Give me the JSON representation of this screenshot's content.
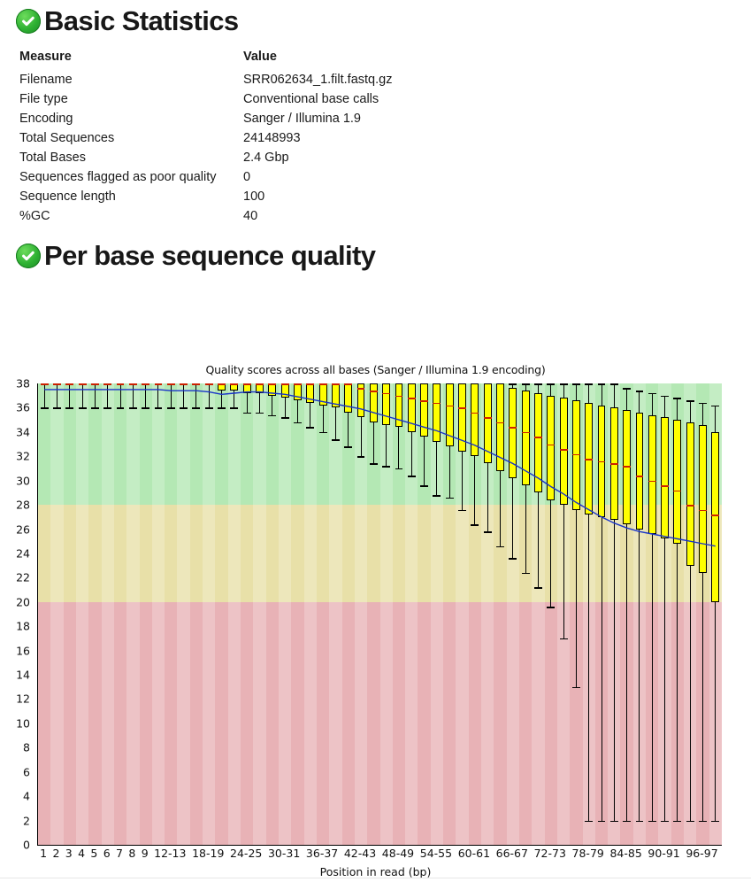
{
  "modules": [
    {
      "id": "basic-statistics",
      "title": "Basic Statistics",
      "status": "pass",
      "status_icon": "check-circle-icon",
      "status_color": "#2db032"
    },
    {
      "id": "per-base-sequence-quality",
      "title": "Per base sequence quality",
      "status": "pass",
      "status_icon": "check-circle-icon",
      "status_color": "#2db032"
    }
  ],
  "basic_statistics": {
    "headers": [
      "Measure",
      "Value"
    ],
    "rows": [
      [
        "Filename",
        "SRR062634_1.filt.fastq.gz"
      ],
      [
        "File type",
        "Conventional base calls"
      ],
      [
        "Encoding",
        "Sanger / Illumina 1.9"
      ],
      [
        "Total Sequences",
        "24148993"
      ],
      [
        "Total Bases",
        "2.4 Gbp"
      ],
      [
        "Sequences flagged as poor quality",
        "0"
      ],
      [
        "Sequence length",
        "100"
      ],
      [
        "%GC",
        "40"
      ]
    ]
  },
  "chart_data": {
    "type": "box",
    "title": "Quality scores across all bases (Sanger / Illumina 1.9 encoding)",
    "xlabel": "Position in read (bp)",
    "ylabel": "",
    "ylim": [
      0,
      38
    ],
    "ytick_step": 2,
    "yticks": [
      0,
      2,
      4,
      6,
      8,
      10,
      12,
      14,
      16,
      18,
      20,
      22,
      24,
      26,
      28,
      30,
      32,
      34,
      36,
      38
    ],
    "grid": false,
    "legend": false,
    "background_bands": [
      {
        "name": "good",
        "from": 28,
        "to": 38,
        "color": "#b4e8b4"
      },
      {
        "name": "warn",
        "from": 20,
        "to": 28,
        "color": "#e8e0a8"
      },
      {
        "name": "bad",
        "from": 0,
        "to": 20,
        "color": "#e8b2b6"
      }
    ],
    "box_color": "#ffff00",
    "median_color": "#cc2200",
    "mean_line_color": "#1a35c8",
    "whisker_color": "#000000",
    "categories": [
      "1",
      "2",
      "3",
      "4",
      "5",
      "6",
      "7",
      "8",
      "9",
      "10-11",
      "12-13",
      "14-15",
      "16-17",
      "18-19",
      "20-21",
      "22-23",
      "24-25",
      "26-27",
      "28-29",
      "30-31",
      "32-33",
      "34-35",
      "36-37",
      "38-39",
      "40-41",
      "42-43",
      "44-45",
      "46-47",
      "48-49",
      "50-51",
      "52-53",
      "54-55",
      "56-57",
      "58-59",
      "60-61",
      "62-63",
      "64-65",
      "66-67",
      "68-69",
      "70-71",
      "72-73",
      "74-75",
      "76-77",
      "78-79",
      "80-81",
      "82-83",
      "84-85",
      "86-87",
      "88-89",
      "90-91",
      "92-93",
      "94-95",
      "96-97",
      "98-99"
    ],
    "xtick_labels": [
      "1",
      "2",
      "3",
      "4",
      "5",
      "6",
      "7",
      "8",
      "9",
      "12-13",
      "18-19",
      "24-25",
      "30-31",
      "36-37",
      "42-43",
      "48-49",
      "54-55",
      "60-61",
      "66-67",
      "72-73",
      "78-79",
      "84-85",
      "90-91",
      "96-97"
    ],
    "xtick_indices": [
      0,
      1,
      2,
      3,
      4,
      5,
      6,
      7,
      8,
      10,
      13,
      16,
      19,
      22,
      25,
      28,
      31,
      34,
      37,
      40,
      43,
      46,
      49,
      52
    ],
    "series": [
      {
        "name": "mean quality",
        "values": [
          37.5,
          37.5,
          37.5,
          37.5,
          37.5,
          37.5,
          37.5,
          37.5,
          37.5,
          37.5,
          37.4,
          37.4,
          37.4,
          37.3,
          37.1,
          37.2,
          37.3,
          37.3,
          37.2,
          37.1,
          36.9,
          36.7,
          36.5,
          36.3,
          36.1,
          35.9,
          35.6,
          35.3,
          35.0,
          34.7,
          34.4,
          34.1,
          33.7,
          33.3,
          32.9,
          32.4,
          31.9,
          31.4,
          30.8,
          30.2,
          29.5,
          28.9,
          28.2,
          27.6,
          27.0,
          26.5,
          26.1,
          25.8,
          25.6,
          25.4,
          25.2,
          25.0,
          24.8,
          24.6
        ]
      }
    ],
    "boxes": [
      {
        "x": "1",
        "lower_whisker": 36,
        "q1": 38,
        "median": 38,
        "q3": 38,
        "upper_whisker": 38
      },
      {
        "x": "2",
        "lower_whisker": 36,
        "q1": 38,
        "median": 38,
        "q3": 38,
        "upper_whisker": 38
      },
      {
        "x": "3",
        "lower_whisker": 36,
        "q1": 38,
        "median": 38,
        "q3": 38,
        "upper_whisker": 38
      },
      {
        "x": "4",
        "lower_whisker": 36,
        "q1": 38,
        "median": 38,
        "q3": 38,
        "upper_whisker": 38
      },
      {
        "x": "5",
        "lower_whisker": 36,
        "q1": 38,
        "median": 38,
        "q3": 38,
        "upper_whisker": 38
      },
      {
        "x": "6",
        "lower_whisker": 36,
        "q1": 38,
        "median": 38,
        "q3": 38,
        "upper_whisker": 38
      },
      {
        "x": "7",
        "lower_whisker": 36,
        "q1": 38,
        "median": 38,
        "q3": 38,
        "upper_whisker": 38
      },
      {
        "x": "8",
        "lower_whisker": 36,
        "q1": 38,
        "median": 38,
        "q3": 38,
        "upper_whisker": 38
      },
      {
        "x": "9",
        "lower_whisker": 36,
        "q1": 38,
        "median": 38,
        "q3": 38,
        "upper_whisker": 38
      },
      {
        "x": "10-11",
        "lower_whisker": 36,
        "q1": 38,
        "median": 38,
        "q3": 38,
        "upper_whisker": 38
      },
      {
        "x": "12-13",
        "lower_whisker": 36,
        "q1": 38,
        "median": 38,
        "q3": 38,
        "upper_whisker": 38
      },
      {
        "x": "14-15",
        "lower_whisker": 36,
        "q1": 38,
        "median": 38,
        "q3": 38,
        "upper_whisker": 38
      },
      {
        "x": "16-17",
        "lower_whisker": 36,
        "q1": 38,
        "median": 38,
        "q3": 38,
        "upper_whisker": 38
      },
      {
        "x": "18-19",
        "lower_whisker": 36,
        "q1": 38,
        "median": 38,
        "q3": 38,
        "upper_whisker": 38
      },
      {
        "x": "20-21",
        "lower_whisker": 36,
        "q1": 37.4,
        "median": 38,
        "q3": 38,
        "upper_whisker": 38
      },
      {
        "x": "22-23",
        "lower_whisker": 36,
        "q1": 37.4,
        "median": 38,
        "q3": 38,
        "upper_whisker": 38
      },
      {
        "x": "24-25",
        "lower_whisker": 35.6,
        "q1": 37.2,
        "median": 38,
        "q3": 38,
        "upper_whisker": 38
      },
      {
        "x": "26-27",
        "lower_whisker": 35.6,
        "q1": 37.2,
        "median": 38,
        "q3": 38,
        "upper_whisker": 38
      },
      {
        "x": "28-29",
        "lower_whisker": 35.4,
        "q1": 37.0,
        "median": 38,
        "q3": 38,
        "upper_whisker": 38
      },
      {
        "x": "30-31",
        "lower_whisker": 35.2,
        "q1": 36.8,
        "median": 38,
        "q3": 38,
        "upper_whisker": 38
      },
      {
        "x": "32-33",
        "lower_whisker": 34.8,
        "q1": 36.6,
        "median": 38,
        "q3": 38,
        "upper_whisker": 38
      },
      {
        "x": "34-35",
        "lower_whisker": 34.4,
        "q1": 36.4,
        "median": 38,
        "q3": 38,
        "upper_whisker": 38
      },
      {
        "x": "36-37",
        "lower_whisker": 34.0,
        "q1": 36.2,
        "median": 38,
        "q3": 38,
        "upper_whisker": 38
      },
      {
        "x": "38-39",
        "lower_whisker": 33.4,
        "q1": 36.0,
        "median": 38,
        "q3": 38,
        "upper_whisker": 38
      },
      {
        "x": "40-41",
        "lower_whisker": 32.8,
        "q1": 35.6,
        "median": 38,
        "q3": 38,
        "upper_whisker": 38
      },
      {
        "x": "42-43",
        "lower_whisker": 32.0,
        "q1": 35.2,
        "median": 37.6,
        "q3": 38,
        "upper_whisker": 38
      },
      {
        "x": "44-45",
        "lower_whisker": 31.4,
        "q1": 34.8,
        "median": 37.4,
        "q3": 38,
        "upper_whisker": 38
      },
      {
        "x": "46-47",
        "lower_whisker": 31.2,
        "q1": 34.6,
        "median": 37.2,
        "q3": 38,
        "upper_whisker": 38
      },
      {
        "x": "48-49",
        "lower_whisker": 31.0,
        "q1": 34.4,
        "median": 37.0,
        "q3": 38,
        "upper_whisker": 38
      },
      {
        "x": "50-51",
        "lower_whisker": 30.4,
        "q1": 34.0,
        "median": 36.8,
        "q3": 38,
        "upper_whisker": 38
      },
      {
        "x": "52-53",
        "lower_whisker": 29.6,
        "q1": 33.6,
        "median": 36.6,
        "q3": 38,
        "upper_whisker": 38
      },
      {
        "x": "54-55",
        "lower_whisker": 28.8,
        "q1": 33.2,
        "median": 36.4,
        "q3": 38,
        "upper_whisker": 38
      },
      {
        "x": "56-57",
        "lower_whisker": 28.6,
        "q1": 32.8,
        "median": 36.2,
        "q3": 38,
        "upper_whisker": 38
      },
      {
        "x": "58-59",
        "lower_whisker": 27.6,
        "q1": 32.4,
        "median": 36.0,
        "q3": 38,
        "upper_whisker": 38
      },
      {
        "x": "60-61",
        "lower_whisker": 26.4,
        "q1": 32.0,
        "median": 35.6,
        "q3": 38,
        "upper_whisker": 38
      },
      {
        "x": "62-63",
        "lower_whisker": 25.8,
        "q1": 31.4,
        "median": 35.2,
        "q3": 38,
        "upper_whisker": 38
      },
      {
        "x": "64-65",
        "lower_whisker": 24.6,
        "q1": 30.8,
        "median": 34.8,
        "q3": 38,
        "upper_whisker": 38
      },
      {
        "x": "66-67",
        "lower_whisker": 23.6,
        "q1": 30.2,
        "median": 34.4,
        "q3": 37.6,
        "upper_whisker": 38
      },
      {
        "x": "68-69",
        "lower_whisker": 22.4,
        "q1": 29.6,
        "median": 34.0,
        "q3": 37.4,
        "upper_whisker": 38
      },
      {
        "x": "70-71",
        "lower_whisker": 21.2,
        "q1": 29.0,
        "median": 33.6,
        "q3": 37.2,
        "upper_whisker": 38
      },
      {
        "x": "72-73",
        "lower_whisker": 19.6,
        "q1": 28.4,
        "median": 33.0,
        "q3": 37.0,
        "upper_whisker": 38
      },
      {
        "x": "74-75",
        "lower_whisker": 17.0,
        "q1": 28.0,
        "median": 32.6,
        "q3": 36.8,
        "upper_whisker": 38
      },
      {
        "x": "76-77",
        "lower_whisker": 13.0,
        "q1": 27.6,
        "median": 32.2,
        "q3": 36.6,
        "upper_whisker": 38
      },
      {
        "x": "78-79",
        "lower_whisker": 2.0,
        "q1": 27.2,
        "median": 31.8,
        "q3": 36.4,
        "upper_whisker": 38
      },
      {
        "x": "80-81",
        "lower_whisker": 2.0,
        "q1": 27.0,
        "median": 31.6,
        "q3": 36.2,
        "upper_whisker": 38
      },
      {
        "x": "82-83",
        "lower_whisker": 2.0,
        "q1": 26.8,
        "median": 31.4,
        "q3": 36.0,
        "upper_whisker": 38
      },
      {
        "x": "84-85",
        "lower_whisker": 2.0,
        "q1": 26.4,
        "median": 31.2,
        "q3": 35.8,
        "upper_whisker": 37.6
      },
      {
        "x": "86-87",
        "lower_whisker": 2.0,
        "q1": 26.0,
        "median": 30.4,
        "q3": 35.6,
        "upper_whisker": 37.4
      },
      {
        "x": "88-89",
        "lower_whisker": 2.0,
        "q1": 25.6,
        "median": 30.0,
        "q3": 35.4,
        "upper_whisker": 37.2
      },
      {
        "x": "90-91",
        "lower_whisker": 2.0,
        "q1": 25.2,
        "median": 29.6,
        "q3": 35.2,
        "upper_whisker": 37.0
      },
      {
        "x": "92-93",
        "lower_whisker": 2.0,
        "q1": 24.8,
        "median": 29.2,
        "q3": 35.0,
        "upper_whisker": 36.8
      },
      {
        "x": "94-95",
        "lower_whisker": 2.0,
        "q1": 23.0,
        "median": 28.0,
        "q3": 34.8,
        "upper_whisker": 36.6
      },
      {
        "x": "96-97",
        "lower_whisker": 2.0,
        "q1": 22.4,
        "median": 27.6,
        "q3": 34.6,
        "upper_whisker": 36.4
      },
      {
        "x": "98-99",
        "lower_whisker": 2.0,
        "q1": 20.0,
        "median": 27.2,
        "q3": 34.0,
        "upper_whisker": 36.2
      }
    ]
  }
}
